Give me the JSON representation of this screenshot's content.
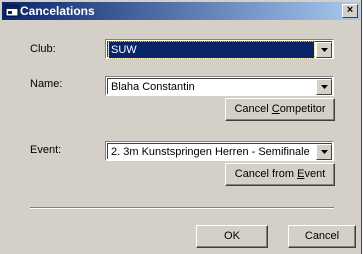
{
  "window": {
    "title": "Cancelations",
    "close_glyph": "×"
  },
  "form": {
    "club_label": "Club:",
    "club_value": "SUW",
    "name_label": "Name:",
    "name_value": "Blaha Constantin",
    "cancel_competitor": {
      "pre": "Cancel ",
      "key": "C",
      "post": "ompetitor"
    },
    "event_label": "Event:",
    "event_value": "2. 3m Kunstspringen Herren - Semifinale",
    "cancel_event": {
      "pre": "Cancel from ",
      "key": "E",
      "post": "vent"
    }
  },
  "footer": {
    "ok_label": "OK",
    "cancel_label": "Cancel"
  },
  "colors": {
    "titlebar_start": "#0a246a",
    "titlebar_end": "#a6caf0",
    "face": "#d4d0c8",
    "selection": "#0a246a"
  },
  "icons": {
    "title": "window-icon",
    "dropdown": "chevron-down-icon"
  }
}
